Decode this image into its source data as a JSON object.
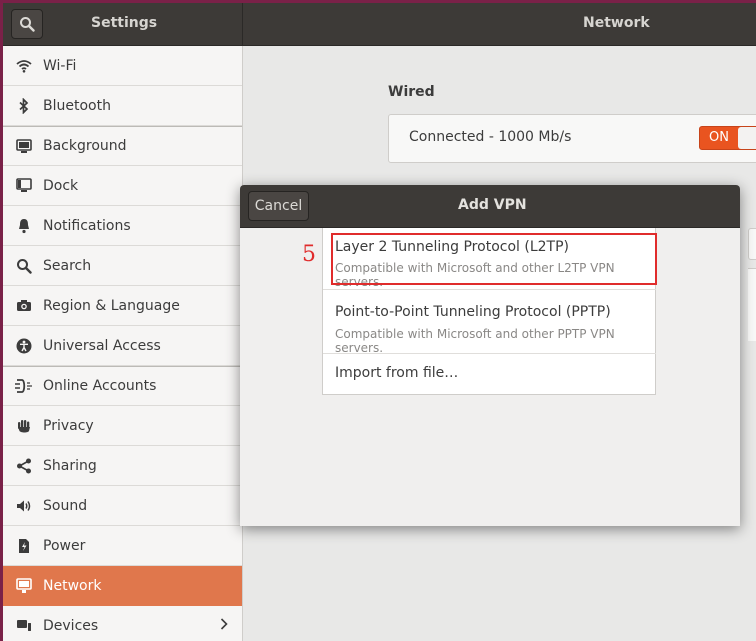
{
  "header": {
    "sidebar_title": "Settings",
    "page_title": "Network",
    "search_icon": "search-icon"
  },
  "sidebar": {
    "items": [
      {
        "label": "Wi-Fi",
        "icon": "wifi-icon"
      },
      {
        "label": "Bluetooth",
        "icon": "bluetooth-icon"
      },
      {
        "label": "Background",
        "icon": "background-icon"
      },
      {
        "label": "Dock",
        "icon": "dock-icon"
      },
      {
        "label": "Notifications",
        "icon": "bell-icon"
      },
      {
        "label": "Search",
        "icon": "search-icon"
      },
      {
        "label": "Region & Language",
        "icon": "camera-icon"
      },
      {
        "label": "Universal Access",
        "icon": "accessibility-icon"
      },
      {
        "label": "Online Accounts",
        "icon": "online-accounts-icon"
      },
      {
        "label": "Privacy",
        "icon": "hand-icon"
      },
      {
        "label": "Sharing",
        "icon": "share-icon"
      },
      {
        "label": "Sound",
        "icon": "speaker-icon"
      },
      {
        "label": "Power",
        "icon": "power-icon"
      },
      {
        "label": "Network",
        "icon": "network-icon",
        "active": true
      },
      {
        "label": "Devices",
        "icon": "devices-icon"
      }
    ]
  },
  "main": {
    "wired_label": "Wired",
    "wired_status": "Connected - 1000 Mb/s",
    "toggle_label": "ON"
  },
  "dialog": {
    "title": "Add VPN",
    "cancel_label": "Cancel",
    "options": [
      {
        "title": "Layer 2 Tunneling Protocol (L2TP)",
        "description": "Compatible with Microsoft and other L2TP VPN servers."
      },
      {
        "title": "Point-to-Point Tunneling Protocol (PPTP)",
        "description": "Compatible with Microsoft and other PPTP VPN servers."
      },
      {
        "title": "Import from file…"
      }
    ]
  },
  "annotation": {
    "step_number": "5"
  },
  "colors": {
    "accent": "#e95420",
    "sidebar_active": "#e0774c",
    "headerbar": "#3d3a37",
    "highlight": "#e02c2c"
  }
}
